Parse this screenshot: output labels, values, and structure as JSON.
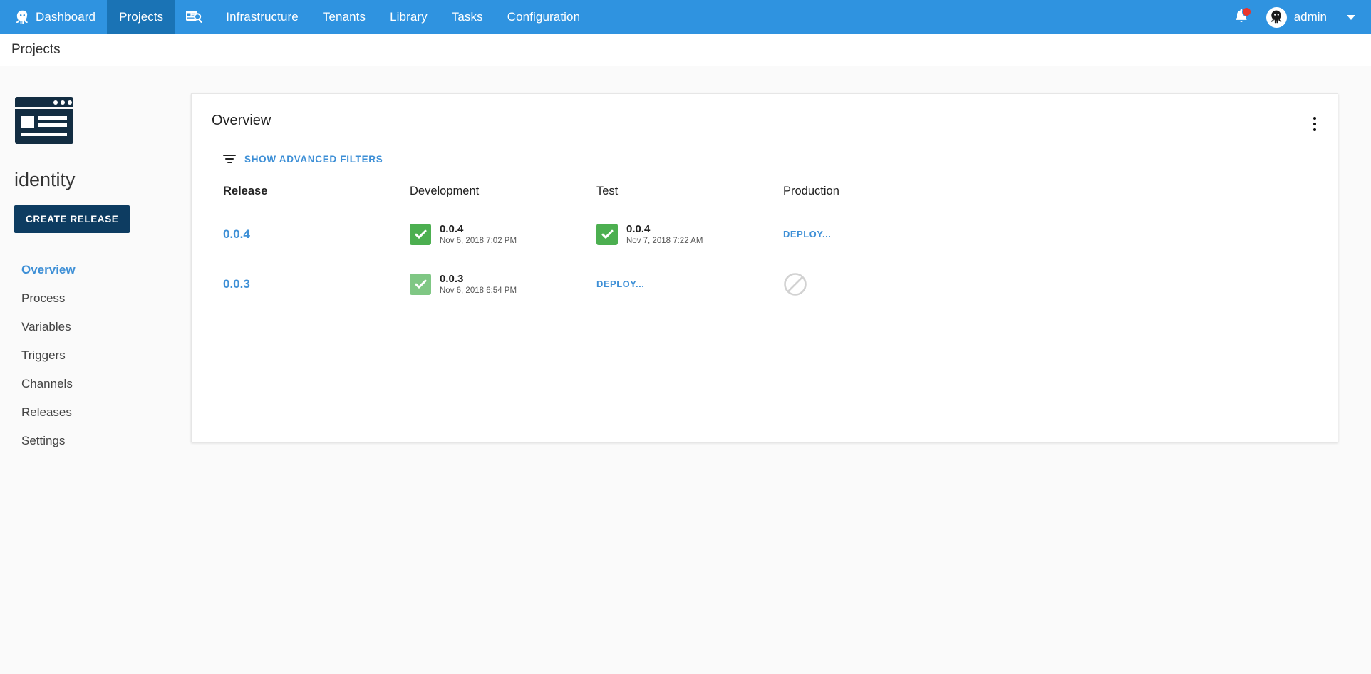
{
  "topnav": {
    "items": [
      {
        "label": "Dashboard",
        "icon": "octopus-logo-icon",
        "active": false
      },
      {
        "label": "Projects",
        "icon": null,
        "active": true
      },
      {
        "label": "",
        "icon": "document-search-icon",
        "active": false
      },
      {
        "label": "Infrastructure",
        "icon": null,
        "active": false
      },
      {
        "label": "Tenants",
        "icon": null,
        "active": false
      },
      {
        "label": "Library",
        "icon": null,
        "active": false
      },
      {
        "label": "Tasks",
        "icon": null,
        "active": false
      },
      {
        "label": "Configuration",
        "icon": null,
        "active": false
      }
    ],
    "notifications": {
      "icon": "bell-icon",
      "badge": ""
    },
    "user": {
      "name": "admin",
      "avatar_icon": "octopus-avatar-icon",
      "caret_icon": "chevron-down-icon"
    },
    "colors": {
      "bar": "#2f93e0",
      "active_tab": "#1a73b5",
      "badge": "#e8352c"
    }
  },
  "breadcrumb": {
    "text": "Projects"
  },
  "sidebar": {
    "project_icon": "project-window-icon",
    "project_name": "identity",
    "create_release_label": "CREATE RELEASE",
    "items": [
      {
        "label": "Overview",
        "active": true
      },
      {
        "label": "Process",
        "active": false
      },
      {
        "label": "Variables",
        "active": false
      },
      {
        "label": "Triggers",
        "active": false
      },
      {
        "label": "Channels",
        "active": false
      },
      {
        "label": "Releases",
        "active": false
      },
      {
        "label": "Settings",
        "active": false
      }
    ]
  },
  "card": {
    "title": "Overview",
    "menu_icon": "kebab-menu-icon",
    "filters": {
      "icon": "filter-icon",
      "label": "SHOW ADVANCED FILTERS"
    },
    "table": {
      "headers": {
        "release": "Release",
        "development": "Development",
        "test": "Test",
        "production": "Production"
      },
      "rows": [
        {
          "release": "0.0.4",
          "development": {
            "state": "deployed",
            "version": "0.0.4",
            "when": "Nov 6, 2018 7:02 PM",
            "faded": false
          },
          "test": {
            "state": "deployed",
            "version": "0.0.4",
            "when": "Nov 7, 2018 7:22 AM",
            "faded": false
          },
          "production": {
            "state": "deploy",
            "label": "DEPLOY..."
          }
        },
        {
          "release": "0.0.3",
          "development": {
            "state": "deployed",
            "version": "0.0.3",
            "when": "Nov 6, 2018 6:54 PM",
            "faded": true
          },
          "test": {
            "state": "deploy",
            "label": "DEPLOY..."
          },
          "production": {
            "state": "blocked",
            "icon": "blocked-icon"
          }
        }
      ]
    }
  },
  "colors": {
    "accent_blue": "#3d8fd6",
    "success_green": "#4caf50",
    "success_green_faded": "#7fc784",
    "dark_navy": "#0d3c61",
    "blocked_grey": "#d0d0d0"
  }
}
